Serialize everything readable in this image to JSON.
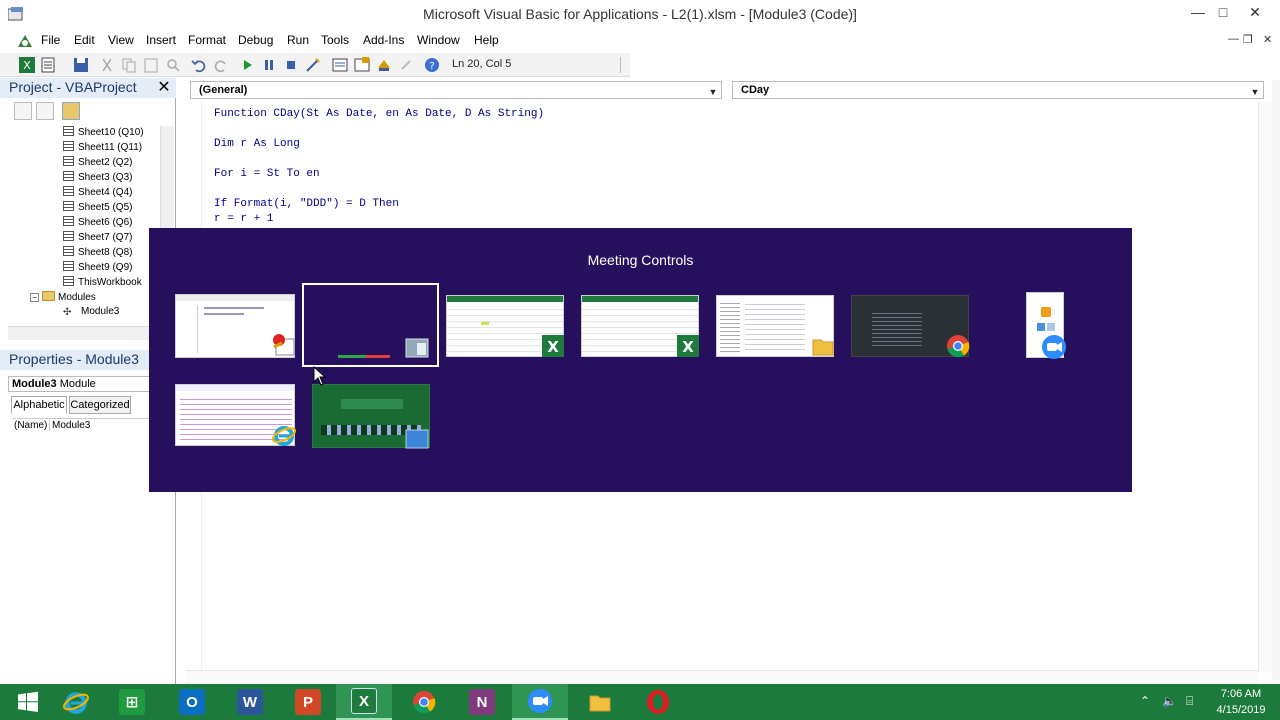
{
  "window": {
    "title": "Microsoft Visual Basic for Applications - L2(1).xlsm - [Module3 (Code)]",
    "minimize": "—",
    "maximize": "□",
    "close": "✕"
  },
  "menu": {
    "items": [
      "File",
      "Edit",
      "View",
      "Insert",
      "Format",
      "Debug",
      "Run",
      "Tools",
      "Add-Ins",
      "Window",
      "Help"
    ],
    "mdi_minimize": "—",
    "mdi_restore": "❐",
    "mdi_close": "✕"
  },
  "toolbar": {
    "position": "Ln 20, Col 5"
  },
  "project": {
    "title": "Project - VBAProject",
    "close": "✕",
    "tree": [
      "Sheet10 (Q10)",
      "Sheet11 (Q11)",
      "Sheet2 (Q2)",
      "Sheet3 (Q3)",
      "Sheet4 (Q4)",
      "Sheet5 (Q5)",
      "Sheet6 (Q6)",
      "Sheet7 (Q7)",
      "Sheet8 (Q8)",
      "Sheet9 (Q9)",
      "ThisWorkbook",
      "Modules",
      "Module3"
    ]
  },
  "properties": {
    "title": "Properties - Module3",
    "object": "Module3",
    "object_type": "Module",
    "tabs": [
      "Alphabetic",
      "Categorized"
    ],
    "row_name": "(Name)",
    "row_value": "Module3"
  },
  "code": {
    "object_combo": "(General)",
    "proc_combo": "CDay",
    "lines": [
      "Function CDay(St As Date, en As Date, D As String)",
      "Dim r As Long",
      "For i = St To en",
      "If Format(i, \"DDD\") = D Then",
      "r = r + 1"
    ]
  },
  "overlay": {
    "title": "Meeting Controls"
  },
  "taskbar": {
    "time": "7:06 AM",
    "date": "4/15/2019"
  }
}
